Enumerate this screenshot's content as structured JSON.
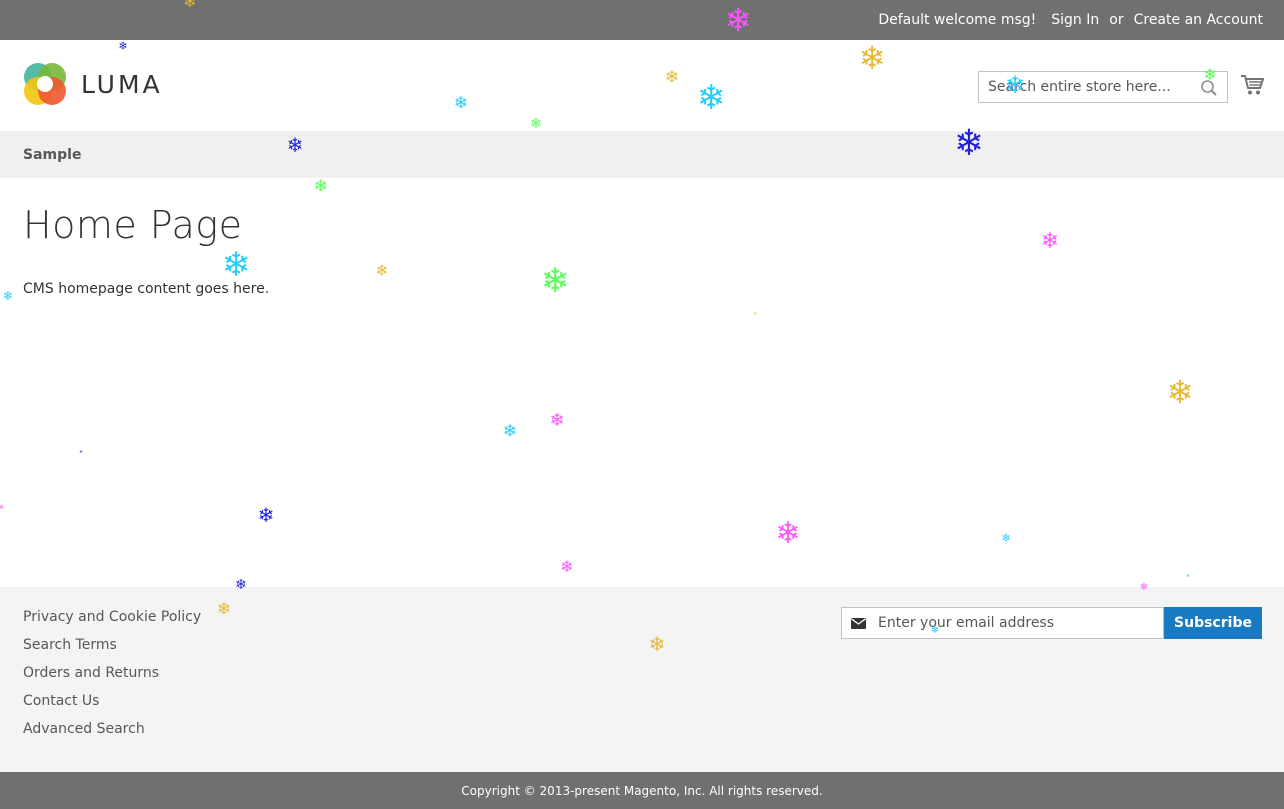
{
  "top_bar": {
    "welcome": "Default welcome msg!",
    "sign_in": "Sign In",
    "or": "or",
    "create_account": "Create an Account"
  },
  "header": {
    "logo_text": "LUMA",
    "search_placeholder": "Search entire store here...",
    "icons": [
      "search-icon",
      "cart-icon"
    ]
  },
  "nav": {
    "items": [
      {
        "label": "Sample"
      }
    ]
  },
  "main": {
    "title": "Home Page",
    "content": "CMS homepage content goes here."
  },
  "footer": {
    "links": [
      {
        "label": "Privacy and Cookie Policy"
      },
      {
        "label": "Search Terms"
      },
      {
        "label": "Orders and Returns"
      },
      {
        "label": "Contact Us"
      },
      {
        "label": "Advanced Search"
      }
    ],
    "newsletter": {
      "placeholder": "Enter your email address",
      "button": "Subscribe"
    },
    "copyright": "Copyright © 2013-present Magento, Inc. All rights reserved."
  },
  "colors": {
    "top_bar": "#6e716e",
    "nav_bg": "#f0f0f0",
    "footer_bg": "#f4f4f4",
    "subscribe": "#1979c3",
    "snow_palette": [
      "#e6b833",
      "#ff55ff",
      "#22ccff",
      "#55ff55",
      "#2222dd"
    ]
  },
  "overlay": {
    "effect": "falling-snowflakes",
    "glyph": "❄"
  }
}
